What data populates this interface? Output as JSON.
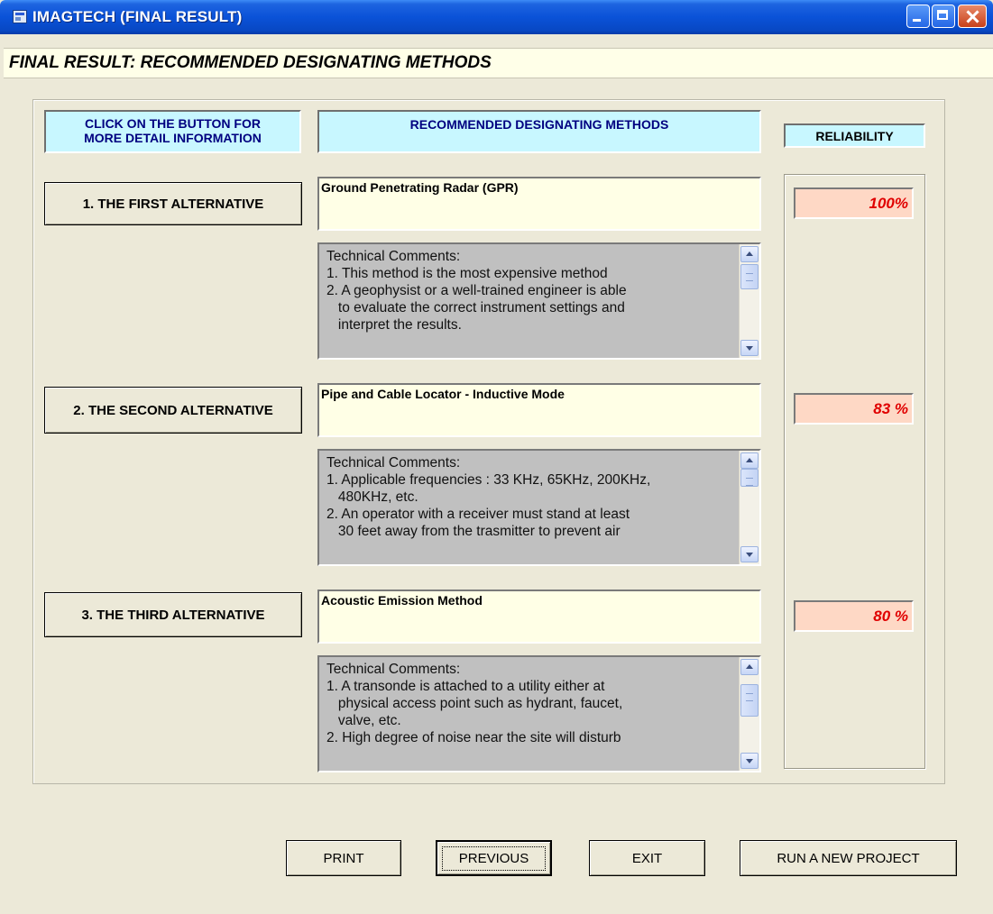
{
  "window": {
    "title": "IMAGTECH (FINAL RESULT)",
    "controls": [
      "minimize",
      "maximize",
      "close"
    ]
  },
  "header": {
    "title": "FINAL RESULT: RECOMMENDED DESIGNATING METHODS"
  },
  "columns": {
    "click_label_line1": "CLICK ON THE BUTTON  FOR",
    "click_label_line2": "MORE DETAIL INFORMATION",
    "methods_label": "RECOMMENDED DESIGNATING METHODS",
    "reliability_label": "RELIABILITY"
  },
  "alternatives": [
    {
      "button_label": "1. THE FIRST ALTERNATIVE",
      "method": "Ground Penetrating Radar (GPR)",
      "comments": "Technical Comments:\n1. This method is the most expensive method\n2. A geophysist or a well-trained engineer is able\n   to evaluate the correct instrument settings and\n   interpret the results.",
      "reliability": "100%"
    },
    {
      "button_label": "2. THE SECOND ALTERNATIVE",
      "method": "Pipe and Cable Locator - Inductive Mode",
      "comments": "Technical Comments:\n1. Applicable frequencies : 33 KHz, 65KHz, 200KHz,\n   480KHz, etc.\n2. An operator with a receiver must stand at least\n   30 feet away from the trasmitter to prevent air",
      "reliability": "83 %"
    },
    {
      "button_label": "3. THE THIRD ALTERNATIVE",
      "method": "Acoustic Emission Method",
      "comments": "Technical Comments:\n1. A transonde is attached to a utility either at\n   physical access point such as hydrant, faucet,\n   valve, etc.\n2. High degree of noise near the site will disturb",
      "reliability": "80 %"
    }
  ],
  "footer_buttons": {
    "print": "PRINT",
    "previous": "PREVIOUS",
    "exit": "EXIT",
    "run_new": "RUN A NEW PROJECT"
  }
}
